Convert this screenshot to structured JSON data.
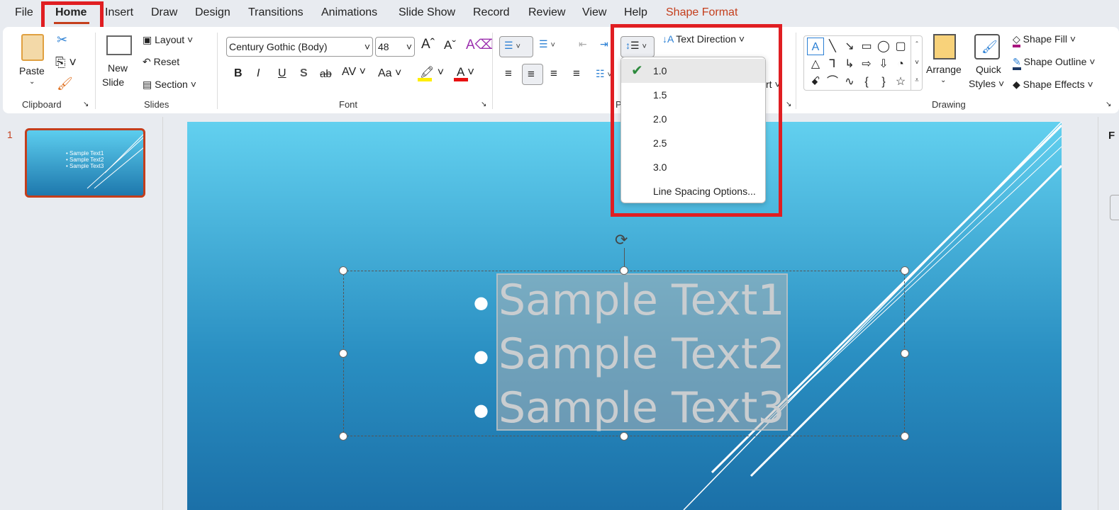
{
  "menu_tabs": [
    "File",
    "Home",
    "Insert",
    "Draw",
    "Design",
    "Transitions",
    "Animations",
    "Slide Show",
    "Record",
    "Review",
    "View",
    "Help",
    "Shape Format"
  ],
  "clipboard": {
    "paste": "Paste",
    "group": "Clipboard"
  },
  "slides": {
    "new_slide": "New",
    "new_slide2": "Slide",
    "layout": "Layout",
    "reset": "Reset",
    "section": "Section",
    "group": "Slides"
  },
  "font": {
    "name": "Century Gothic (Body)",
    "size": "48",
    "group": "Font",
    "bold": "B",
    "italic": "I",
    "underline": "U",
    "shadow": "S",
    "strike": "ab",
    "spacing": "AV",
    "case": "Aa",
    "grow": "A",
    "shrink": "A",
    "color": "A"
  },
  "paragraph": {
    "text_direction": "Text Direction",
    "group_partial": "P",
    "align_partial": "rt"
  },
  "drawing": {
    "arrange": "Arrange",
    "quick": "Quick",
    "styles": "Styles",
    "shape_fill": "Shape Fill",
    "shape_outline": "Shape Outline",
    "shape_effects": "Shape Effects",
    "group": "Drawing",
    "shapes": [
      "A",
      "╲",
      "↘",
      "▭",
      "◯",
      "▢",
      "△",
      "⅂",
      "↳",
      "⇨",
      "⇩",
      "◔",
      "ꗃ",
      "⌒",
      "∿",
      "{",
      "}",
      "☆"
    ]
  },
  "line_spacing_menu": {
    "items": [
      "1.0",
      "1.5",
      "2.0",
      "2.5",
      "3.0"
    ],
    "selected": "1.0",
    "options": "Line Spacing Options..."
  },
  "thumbnail": {
    "number": "1",
    "lines": [
      "• Sample Text1",
      "• Sample Text2",
      "• Sample Text3"
    ]
  },
  "slide": {
    "lines": [
      "Sample Text1",
      "Sample Text2",
      "Sample Text3"
    ]
  },
  "right_panel_partial": "F",
  "colors": {
    "accent": "#c43e1c",
    "highlight": "#e01e22"
  }
}
